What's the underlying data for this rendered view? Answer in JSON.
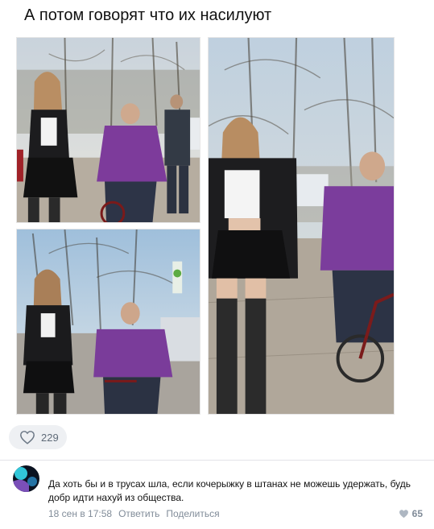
{
  "post": {
    "title": "А потом говорят что их насилуют",
    "likes": "229"
  },
  "photos": [
    {
      "name": "photo-girl-and-old-man-bicycle-1"
    },
    {
      "name": "photo-girl-and-old-man-bicycle-2"
    },
    {
      "name": "photo-girl-and-old-man-bicycle-3"
    }
  ],
  "comment": {
    "text": "Да хоть бы и в трусах шла, если кочерыжку в штанах не можешь удержать, будь добр идти нахуй из общества.",
    "date": "18 сен в 17:58",
    "reply_label": "Ответить",
    "share_label": "Поделиться",
    "likes": "65"
  },
  "colors": {
    "accent": "#5181b8",
    "muted": "#818c99",
    "like_bg": "#eef0f3"
  }
}
